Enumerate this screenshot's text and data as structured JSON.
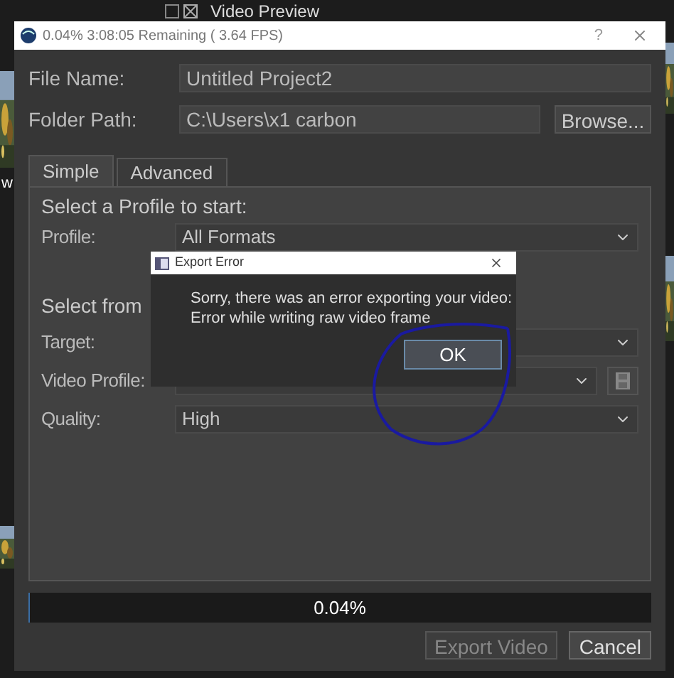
{
  "background": {
    "title": "Video Preview",
    "side_label": "w"
  },
  "window": {
    "title": "0.04%  3:08:05 Remaining ( 3.64 FPS)",
    "help": "?"
  },
  "fields": [
    {
      "label": "File Name:",
      "value": "Untitled Project2"
    },
    {
      "label": "Folder Path:",
      "value": "C:\\Users\\x1 carbon",
      "button": "Browse..."
    }
  ],
  "tabs": [
    {
      "label": "Simple",
      "selected": true
    },
    {
      "label": "Advanced",
      "selected": false
    }
  ],
  "panel": [
    {
      "kind": "heading",
      "text": "Select a Profile to start:"
    },
    {
      "kind": "combo",
      "label": "Profile:",
      "value": "All Formats"
    },
    {
      "kind": "heading",
      "text": "Select from"
    },
    {
      "kind": "combo",
      "label": "Target:"
    },
    {
      "kind": "combo_save",
      "label": "Video Profile:"
    },
    {
      "kind": "combo",
      "label": "Quality:",
      "value": "High"
    }
  ],
  "progress": {
    "level": 0.0004,
    "text": "0.04%"
  },
  "buttons": [
    {
      "label": "Export Video",
      "disabled": true
    },
    {
      "label": "Cancel",
      "disabled": false
    }
  ],
  "error_dialog": {
    "title": "Export Error",
    "message": "Sorry, there was an error exporting your video:\nError while writing raw video frame",
    "button": "OK"
  }
}
